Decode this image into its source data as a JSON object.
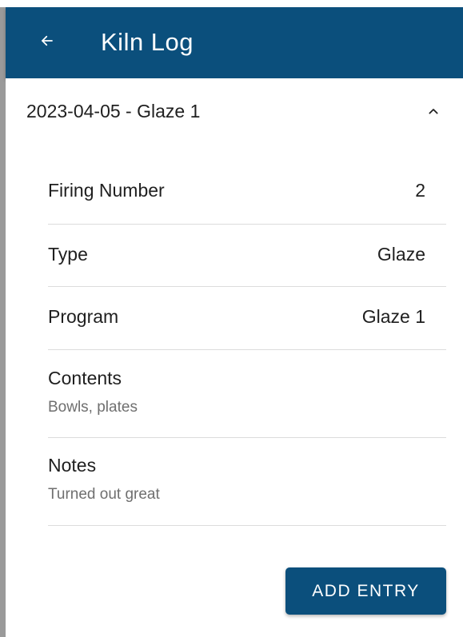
{
  "app_bar": {
    "title": "Kiln Log",
    "back_icon": "arrow-left-icon",
    "background": "#0b4f7c"
  },
  "entry": {
    "title": "2023-04-05 - Glaze 1",
    "expanded": true,
    "toggle_icon": "chevron-up-icon",
    "fields": {
      "firing_number": {
        "label": "Firing Number",
        "value": "2"
      },
      "type": {
        "label": "Type",
        "value": "Glaze"
      },
      "program": {
        "label": "Program",
        "value": "Glaze 1"
      },
      "contents": {
        "label": "Contents",
        "value": "Bowls, plates"
      },
      "notes": {
        "label": "Notes",
        "value": "Turned out great"
      }
    }
  },
  "actions": {
    "add_entry_label": "ADD ENTRY"
  },
  "colors": {
    "primary": "#0b4f7c",
    "divider": "#dcdcdc",
    "secondary_text": "#6f6f6f"
  }
}
